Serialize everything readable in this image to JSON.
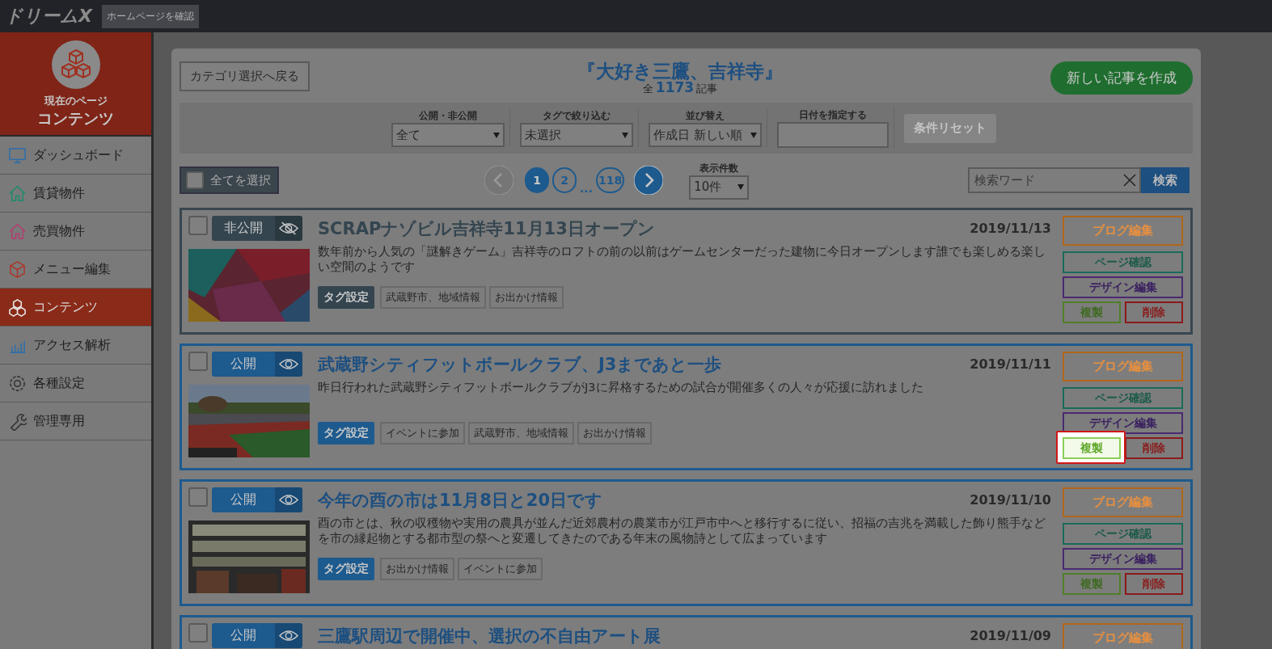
{
  "topbar": {
    "logo": "ドリームX",
    "site_button": "ホームページを確認"
  },
  "sidebar": {
    "current_label": "現在のページ",
    "current_title": "コンテンツ",
    "items": [
      {
        "label": "ダッシュボード",
        "selected": false
      },
      {
        "label": "賃貸物件",
        "selected": false
      },
      {
        "label": "売買物件",
        "selected": false
      },
      {
        "label": "メニュー編集",
        "selected": false
      },
      {
        "label": "コンテンツ",
        "selected": true
      },
      {
        "label": "アクセス解析",
        "selected": false
      },
      {
        "label": "各種設定",
        "selected": false
      },
      {
        "label": "管理専用",
        "selected": false
      }
    ]
  },
  "header": {
    "back_button": "カテゴリ選択へ戻る",
    "title": "『大好き三鷹、吉祥寺』",
    "count_prefix": "全",
    "count": "1173",
    "count_suffix": "記事",
    "new_button": "新しい記事を作成"
  },
  "filters": [
    {
      "kind": "select",
      "label": "公開・非公開",
      "value": "全て"
    },
    {
      "kind": "select",
      "label": "タグで絞り込む",
      "value": "未選択"
    },
    {
      "kind": "select",
      "label": "並び替え",
      "value": "作成日 新しい順"
    },
    {
      "kind": "text",
      "label": "日付を指定する"
    }
  ],
  "reset_button": {
    "label": "条件リセット",
    "disabled": true
  },
  "select_all": {
    "label": "全てを選択",
    "checked": false
  },
  "pagination": {
    "prev_disabled": true,
    "next_disabled": false,
    "ellipsis": "...",
    "pages": [
      {
        "label": "1",
        "selected": true
      },
      {
        "label": "2",
        "selected": false
      },
      {
        "label": "118",
        "selected": false
      }
    ]
  },
  "per_page": {
    "label": "表示件数",
    "value": "10件"
  },
  "search": {
    "placeholder": "検索ワード",
    "button": "検索"
  },
  "articles": [
    {
      "checked": false,
      "published": false,
      "status": "非公開",
      "title": "SCRAPナゾビル吉祥寺11月13日オープン",
      "date": "2019/11/13",
      "thumbnail": {
        "kind": "picture"
      },
      "excerpt": "数年前から人気の「謎解きゲーム」吉祥寺のロフトの前の以前はゲームセンターだった建物に今日オープンします誰でも楽しめる楽しい空間のようです",
      "tag_button": "タグ設定",
      "tags": [
        "武蔵野市、地域情報",
        "お出かけ情報"
      ],
      "actions": [
        {
          "kind": "blog",
          "label": "ブログ編集",
          "highlighted": false
        },
        {
          "kind": "page",
          "label": "ページ確認",
          "highlighted": false
        },
        {
          "kind": "design",
          "label": "デザイン編集",
          "highlighted": false
        },
        {
          "kind": "copy",
          "label": "複製",
          "highlighted": false
        },
        {
          "kind": "delete",
          "label": "削除",
          "highlighted": false
        }
      ]
    },
    {
      "checked": false,
      "published": true,
      "status": "公開",
      "title": "武蔵野シティフットボールクラブ、J3まであと一歩",
      "date": "2019/11/11",
      "thumbnail": {
        "kind": "picture"
      },
      "excerpt": "昨日行われた武蔵野シティフットボールクラブがJ3に昇格するための試合が開催多くの人々が応援に訪れました",
      "tag_button": "タグ設定",
      "tags": [
        "イベントに参加",
        "武蔵野市、地域情報",
        "お出かけ情報"
      ],
      "actions": [
        {
          "kind": "blog",
          "label": "ブログ編集",
          "highlighted": false
        },
        {
          "kind": "page",
          "label": "ページ確認",
          "highlighted": false
        },
        {
          "kind": "design",
          "label": "デザイン編集",
          "highlighted": false
        },
        {
          "kind": "copy",
          "label": "複製",
          "highlighted": true
        },
        {
          "kind": "delete",
          "label": "削除",
          "highlighted": false
        }
      ]
    },
    {
      "checked": false,
      "published": true,
      "status": "公開",
      "title": "今年の酉の市は11月8日と20日です",
      "date": "2019/11/10",
      "thumbnail": {
        "kind": "picture"
      },
      "excerpt": "酉の市とは、秋の収穫物や実用の農具が並んだ近郊農村の農業市が江戸市中へと移行するに従い、招福の吉兆を満載した飾り熊手などを市の縁起物とする都市型の祭へと変遷してきたのである年末の風物詩として広まっています",
      "tag_button": "タグ設定",
      "tags": [
        "お出かけ情報",
        "イベントに参加"
      ],
      "actions": [
        {
          "kind": "blog",
          "label": "ブログ編集",
          "highlighted": false
        },
        {
          "kind": "page",
          "label": "ページ確認",
          "highlighted": false
        },
        {
          "kind": "design",
          "label": "デザイン編集",
          "highlighted": false
        },
        {
          "kind": "copy",
          "label": "複製",
          "highlighted": false
        },
        {
          "kind": "delete",
          "label": "削除",
          "highlighted": false
        }
      ]
    },
    {
      "checked": false,
      "published": true,
      "status": "公開",
      "title": "三鷹駅周辺で開催中、選択の不自由アート展",
      "date": "2019/11/09",
      "actions": [
        {
          "kind": "blog",
          "label": "ブログ編集",
          "highlighted": false
        }
      ]
    }
  ]
}
